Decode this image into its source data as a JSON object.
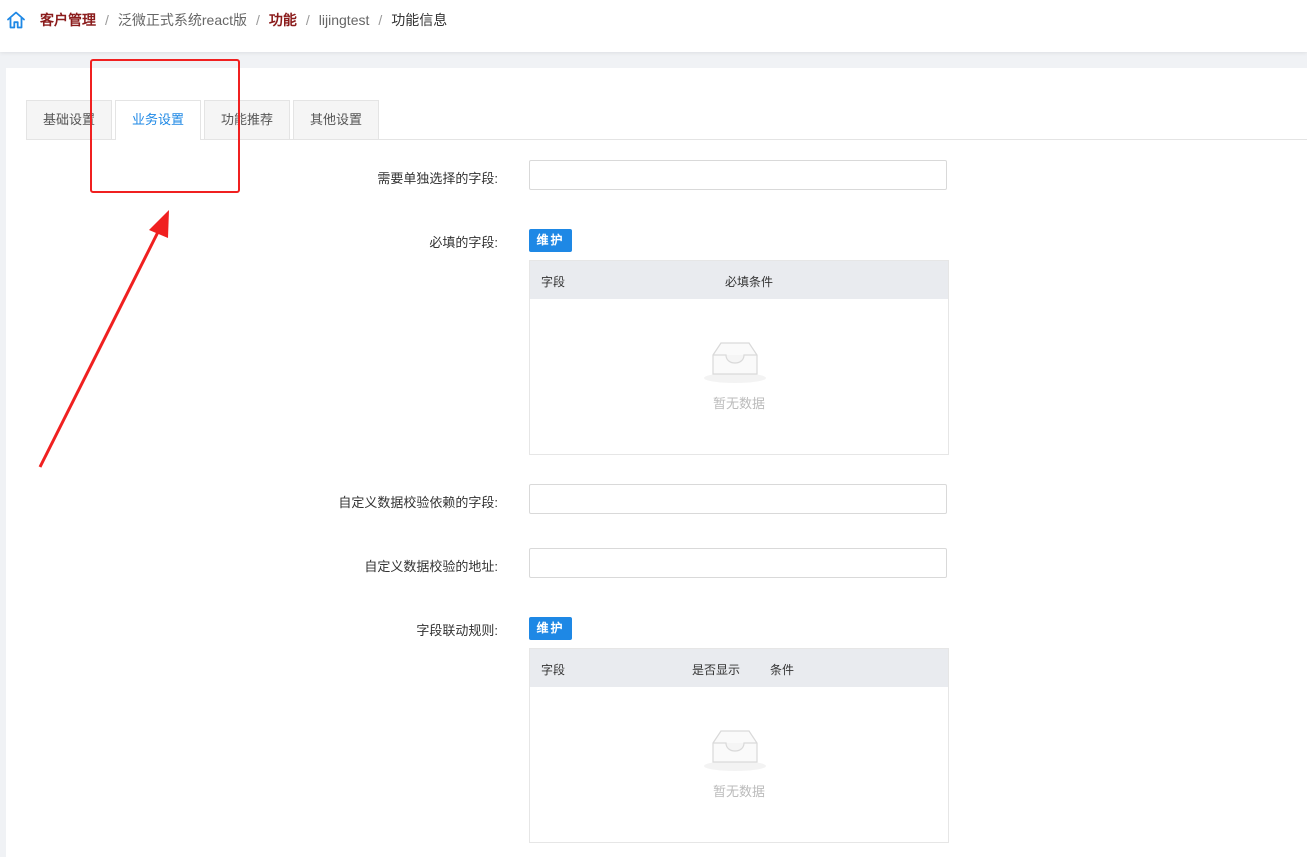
{
  "breadcrumb": {
    "items": [
      {
        "label": "客户管理"
      },
      {
        "label": "泛微正式系统react版"
      },
      {
        "label": "功能"
      },
      {
        "label": "lijingtest"
      },
      {
        "label": "功能信息"
      }
    ],
    "separator": "/"
  },
  "tabs": [
    {
      "label": "基础设置",
      "active": false
    },
    {
      "label": "业务设置",
      "active": true
    },
    {
      "label": "功能推荐",
      "active": false
    },
    {
      "label": "其他设置",
      "active": false
    }
  ],
  "form": {
    "single_select_fields": {
      "label": "需要单独选择的字段:",
      "value": ""
    },
    "required_fields": {
      "label": "必填的字段:",
      "button_label": "维护",
      "columns": [
        "字段",
        "必填条件"
      ],
      "empty_text": "暂无数据"
    },
    "custom_validation_fields": {
      "label": "自定义数据校验依赖的字段:",
      "value": ""
    },
    "custom_validation_url": {
      "label": "自定义数据校验的地址:",
      "value": ""
    },
    "field_linkage_rules": {
      "label": "字段联动规则:",
      "button_label": "维护",
      "columns": [
        "字段",
        "是否显示",
        "条件"
      ],
      "empty_text": "暂无数据"
    }
  },
  "colors": {
    "accent": "#1e88e5",
    "breadcrumb_bold": "#8b1c1c",
    "annotation": "#f02020"
  },
  "icons": {
    "home": "home-icon",
    "empty": "empty-inbox-icon"
  }
}
